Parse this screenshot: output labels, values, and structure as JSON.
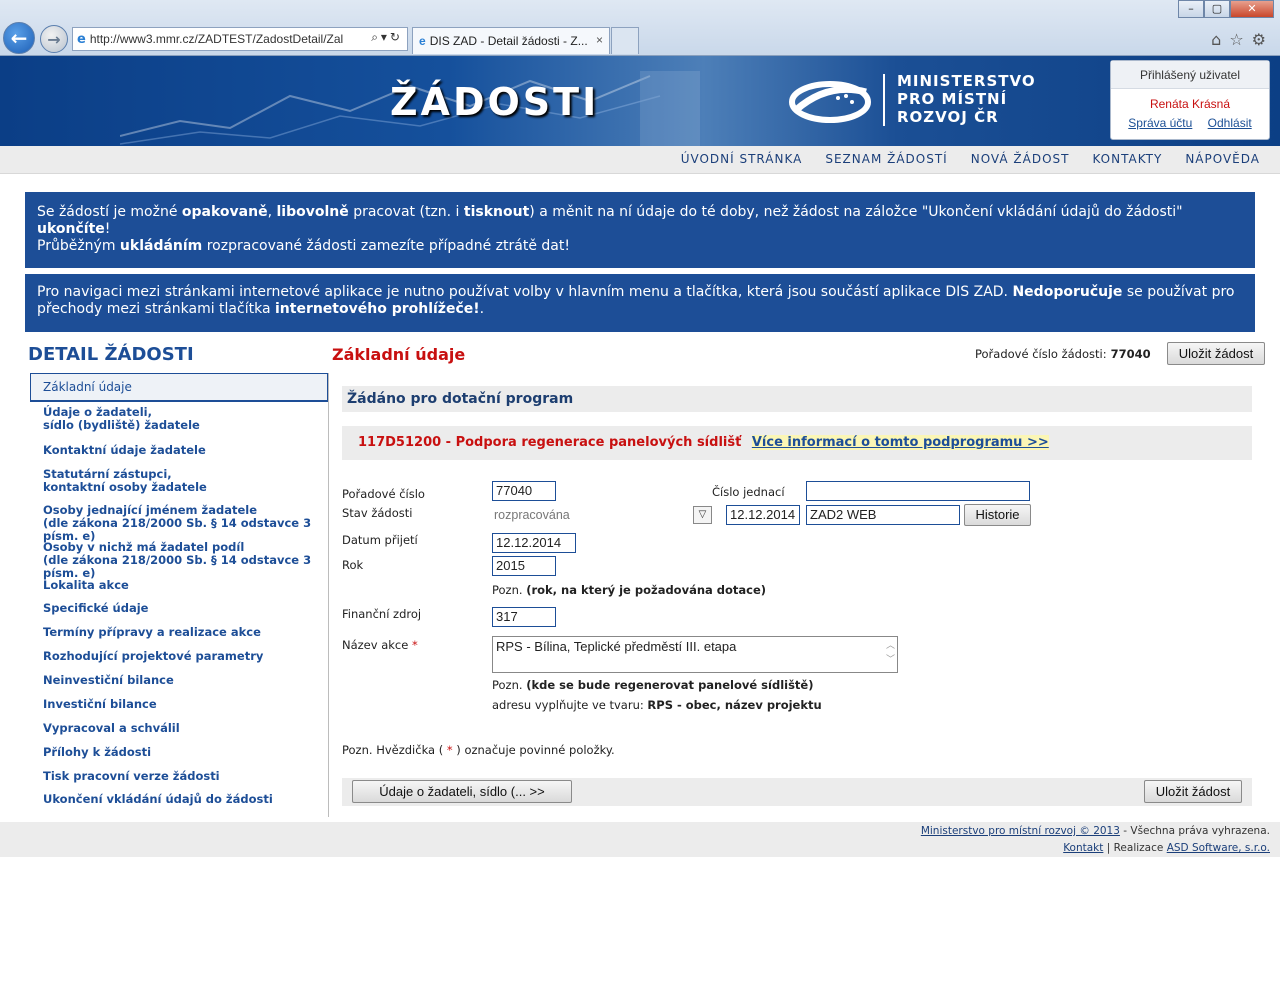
{
  "browser": {
    "url": "http://www3.mmr.cz/ZADTEST/ZadostDetail/Zal",
    "tab_title": "DIS ZAD - Detail žádosti - Z...",
    "tab_close": "×",
    "win_min": "–",
    "win_max": "▢",
    "win_close": "✕",
    "icons": [
      "home-icon",
      "star-icon",
      "gear-icon"
    ]
  },
  "header": {
    "title": "ŽÁDOSTI",
    "ministry_line1": "MINISTERSTVO",
    "ministry_line2": "PRO MÍSTNÍ",
    "ministry_line3": "ROZVOJ ČR",
    "user_box_title": "Přihlášený uživatel",
    "user_name": "Renáta Krásná",
    "account_link": "Správa účtu",
    "logout_link": "Odhlásit"
  },
  "topmenu": [
    "ÚVODNÍ STRÁNKA",
    "SEZNAM ŽÁDOSTÍ",
    "NOVÁ ŽÁDOST",
    "KONTAKTY",
    "NÁPOVĚDA"
  ],
  "info1": {
    "t1": "Se žádostí je možné ",
    "b1": "opakovaně",
    "t2": ", ",
    "b2": "libovolně",
    "t3": " pracovat (tzn. i ",
    "b3": "tisknout",
    "t4": ") a měnit na ní údaje do té doby, než žádost na záložce \"Ukončení vkládání údajů do žádosti\" ",
    "b4": "ukončíte",
    "t5": "!",
    "t6": "Průběžným ",
    "b5": "ukládáním",
    "t7": " rozpracované žádosti zamezíte případné ztrátě dat!"
  },
  "info2": {
    "t1": "Pro navigaci mezi stránkami internetové aplikace je nutno používat volby v hlavním menu a tlačítka, která jsou součástí aplikace DIS ZAD. ",
    "b1": "Nedoporučuje",
    "t2": " se používat pro přechody mezi stránkami tlačítka ",
    "b2": "internetového prohlížeče!",
    "t3": "."
  },
  "left_title": "DETAIL ŽÁDOSTI",
  "sidenav": {
    "active": "Základní údaje",
    "items": [
      {
        "l1": "Údaje o žadateli,",
        "l2": "sídlo (bydliště) žadatele"
      },
      {
        "l1": "Kontaktní údaje žadatele",
        "l2": ""
      },
      {
        "l1": "Statutární zástupci,",
        "l2": "kontaktní osoby žadatele"
      },
      {
        "l1": "Osoby jednající jménem žadatele",
        "l2": "(dle zákona 218/2000 Sb. § 14 odstavce 3 písm. e)"
      },
      {
        "l1": "Osoby v nichž má žadatel podíl",
        "l2": "(dle zákona 218/2000 Sb. § 14 odstavce 3 písm. e)"
      },
      {
        "l1": "Lokalita akce",
        "l2": ""
      },
      {
        "l1": "Specifické údaje",
        "l2": ""
      },
      {
        "l1": "Termíny přípravy a realizace akce",
        "l2": ""
      },
      {
        "l1": "Rozhodující projektové parametry",
        "l2": ""
      },
      {
        "l1": "Neinvestiční bilance",
        "l2": ""
      },
      {
        "l1": "Investiční bilance",
        "l2": ""
      },
      {
        "l1": "Vypracoval a schválil",
        "l2": ""
      },
      {
        "l1": "Přílohy k žádosti",
        "l2": ""
      },
      {
        "l1": "Tisk pracovní verze žádosti",
        "l2": ""
      },
      {
        "l1": "Ukončení vkládání údajů do žádosti",
        "l2": ""
      }
    ]
  },
  "main": {
    "section_title": "Základní údaje",
    "order_label": "Pořadové číslo žádosti:",
    "order_value": "77040",
    "save_button": "Uložit žádost",
    "program_header": "Žádáno pro dotační program",
    "program_code": "117D51200 - Podpora regenerace panelových sídlišť",
    "program_more": "Více informací o tomto podprogramu >>",
    "poradove_label": "Pořadové číslo",
    "poradove_value": "77040",
    "cislo_jednaci_label": "Číslo jednací",
    "cislo_jednaci_value": "",
    "stav_label": "Stav žádosti",
    "stav_value": "rozpracována",
    "stav_date": "12.12.2014",
    "stav_source": "ZAD2 WEB",
    "history_button": "Historie",
    "datum_label": "Datum přijetí",
    "datum_value": "12.12.2014",
    "rok_label": "Rok",
    "rok_value": "2015",
    "rok_note_prefix": "Pozn.",
    "rok_note": "(rok, na který je požadována dotace)",
    "zdroj_label": "Finanční zdroj",
    "zdroj_value": "317",
    "nazev_label": "Název akce",
    "required_mark": "*",
    "nazev_value": "RPS - Bílina, Teplické předměstí III. etapa",
    "nazev_note_prefix": "Pozn.",
    "nazev_note": "(kde se bude regenerovat panelové sídliště)",
    "nazev_format_prefix": "adresu vyplňujte ve tvaru:",
    "nazev_format": "RPS - obec, název projektu",
    "legend_prefix": "Pozn. Hvězdička (",
    "legend_suffix": ") označuje povinné položky.",
    "next_button": "Údaje o žadateli, sídlo (...  >>"
  },
  "footer": {
    "line1_link": "Ministerstvo pro místní rozvoj © 2013",
    "line1_rest": " - Všechna práva vyhrazena.",
    "line2_link1": "Kontakt",
    "line2_sep": " | Realizace ",
    "line2_link2": "ASD Software, s.r.o."
  },
  "colors": {
    "brand_blue": "#1d4e97",
    "accent_red": "#c81010",
    "panel_gray": "#ececec"
  }
}
